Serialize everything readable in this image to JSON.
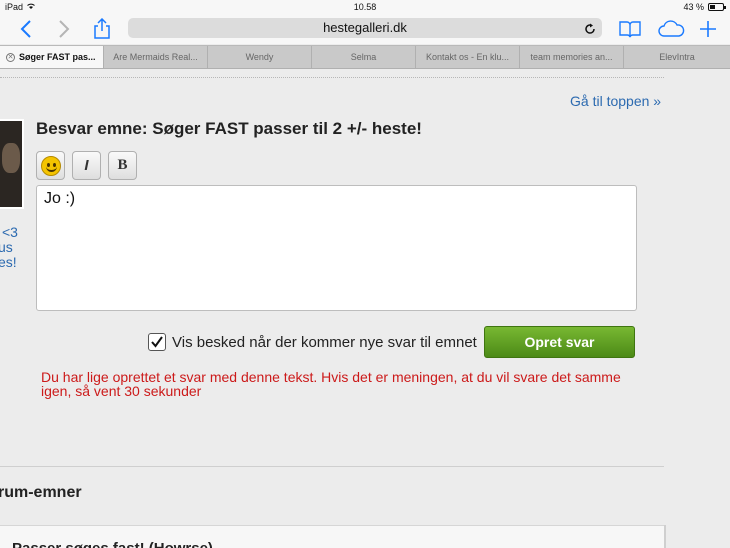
{
  "status": {
    "device": "iPad",
    "time": "10.58",
    "battery": "43 %"
  },
  "browser": {
    "url": "hestegalleri.dk"
  },
  "tabs": [
    {
      "label": "Søger FAST pas..."
    },
    {
      "label": "Are Mermaids Real..."
    },
    {
      "label": "Wendy"
    },
    {
      "label": "Selma"
    },
    {
      "label": "Kontakt os - En klu..."
    },
    {
      "label": "team memories an..."
    },
    {
      "label": "ElevIntra"
    }
  ],
  "page": {
    "top_link": "Gå til toppen »",
    "side_text": [
      "<3",
      "us",
      "es!"
    ],
    "reply_title": "Besvar emne: Søger FAST passer til 2 +/- heste!",
    "format": {
      "italic": "I",
      "bold": "B"
    },
    "textarea_value": "Jo :)",
    "notify_label": "Vis besked når der kommer nye svar til emnet",
    "submit_label": "Opret svar",
    "error_text": "Du har lige oprettet et svar med denne tekst. Hvis det er meningen, at du vil svare det samme igen, så vent 30 sekunder",
    "section_title": "rum-emner",
    "card_title": "Passer søges fast! (Howrse)"
  },
  "colors": {
    "link": "#2c6ab0",
    "error": "#cc1a1a",
    "submit": "#5e9e22",
    "ios_blue": "#1a7aff"
  }
}
